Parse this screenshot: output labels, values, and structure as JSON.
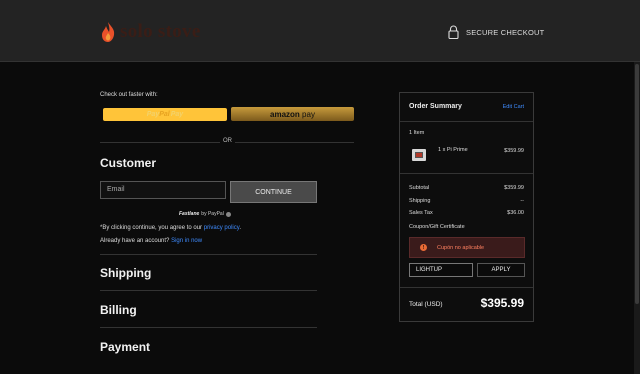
{
  "header": {
    "logo_text": "solo stove",
    "secure_label": "SECURE CHECKOUT"
  },
  "express": {
    "label": "Check out faster with:",
    "paypal_p1": "Pay",
    "paypal_p2": "Pal",
    "paypal_later": "Pay",
    "amazon_a": "amazon",
    "amazon_b": " pay",
    "or": "OR"
  },
  "customer": {
    "heading": "Customer",
    "email_placeholder": "Email",
    "continue_label": "CONTINUE",
    "fastlane_a": "Fastlane",
    "fastlane_b": "by PayPal",
    "consent_pre": "*By clicking continue, you agree to our ",
    "privacy_link": "privacy policy",
    "consent_post": ".",
    "account_q": "Already have an account? ",
    "signin_link": "Sign in now"
  },
  "sections": {
    "shipping": "Shipping",
    "billing": "Billing",
    "payment": "Payment"
  },
  "summary": {
    "title": "Order Summary",
    "edit": "Edit Cart",
    "items_count": "1 Item",
    "item_name": "1 x Pi Prime",
    "item_price": "$359.99",
    "subtotal_label": "Subtotal",
    "subtotal": "$359.99",
    "shipping_label": "Shipping",
    "shipping": "--",
    "tax_label": "Sales Tax",
    "tax": "$36.00",
    "coupon_label": "Coupon/Gift Certificate",
    "alert_text": "Cupón no aplicable",
    "coupon_value": "LIGHTUP",
    "apply_label": "APPLY",
    "total_label": "Total (USD)",
    "total": "$395.99"
  },
  "colors": {
    "accent_link": "#3f8cff",
    "paypal_yellow": "#ffc439",
    "alert_text": "#ff8060",
    "alert_bg": "#3a1b1b"
  },
  "icons": [
    "flame-logo-icon",
    "lock-icon",
    "alert-icon",
    "fastlane-info-icon"
  ]
}
